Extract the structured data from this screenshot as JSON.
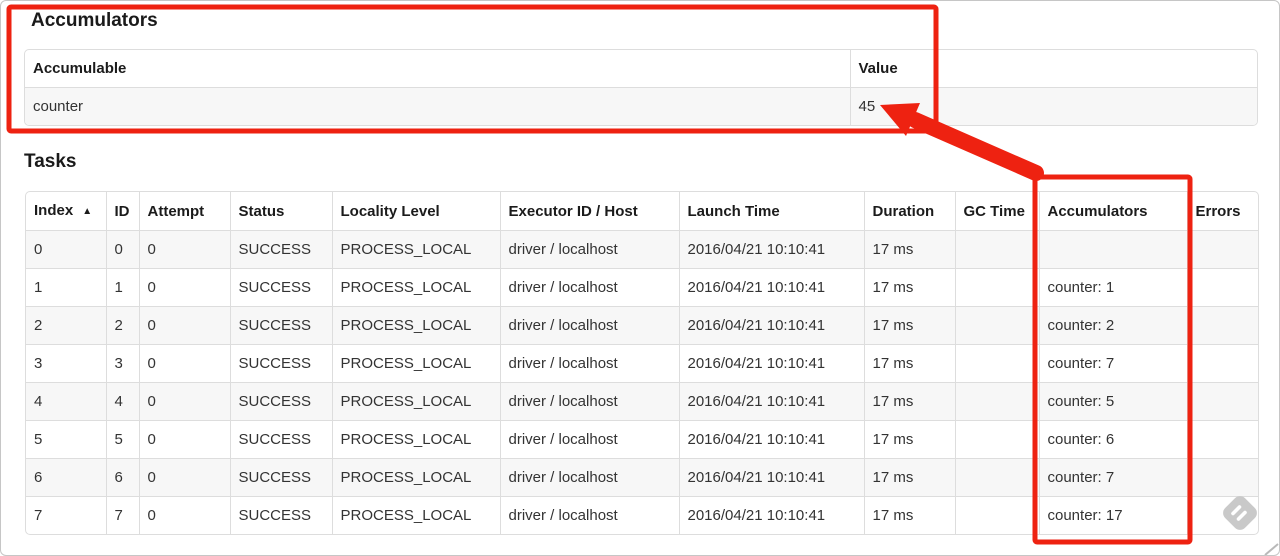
{
  "annotation": {
    "color": "#ee2211",
    "corner_mark_color": "#b9b9b9"
  },
  "watermark": {
    "icon": "feedly-icon",
    "color": "#c9c9c9"
  },
  "accumulators": {
    "title": "Accumulators",
    "headers": {
      "accumulable": "Accumulable",
      "value": "Value"
    },
    "rows": [
      {
        "accumulable": "counter",
        "value": "45"
      }
    ]
  },
  "tasks": {
    "title": "Tasks",
    "sort_icon": "▲",
    "headers": {
      "index": "Index",
      "id": "ID",
      "attempt": "Attempt",
      "status": "Status",
      "locality": "Locality Level",
      "executor": "Executor ID / Host",
      "launch": "Launch Time",
      "duration": "Duration",
      "gc": "GC Time",
      "accumulators": "Accumulators",
      "errors": "Errors"
    },
    "rows": [
      {
        "index": "0",
        "id": "0",
        "attempt": "0",
        "status": "SUCCESS",
        "locality": "PROCESS_LOCAL",
        "executor": "driver / localhost",
        "launch": "2016/04/21 10:10:41",
        "duration": "17 ms",
        "gc": "",
        "accumulators": "",
        "errors": ""
      },
      {
        "index": "1",
        "id": "1",
        "attempt": "0",
        "status": "SUCCESS",
        "locality": "PROCESS_LOCAL",
        "executor": "driver / localhost",
        "launch": "2016/04/21 10:10:41",
        "duration": "17 ms",
        "gc": "",
        "accumulators": "counter: 1",
        "errors": ""
      },
      {
        "index": "2",
        "id": "2",
        "attempt": "0",
        "status": "SUCCESS",
        "locality": "PROCESS_LOCAL",
        "executor": "driver / localhost",
        "launch": "2016/04/21 10:10:41",
        "duration": "17 ms",
        "gc": "",
        "accumulators": "counter: 2",
        "errors": ""
      },
      {
        "index": "3",
        "id": "3",
        "attempt": "0",
        "status": "SUCCESS",
        "locality": "PROCESS_LOCAL",
        "executor": "driver / localhost",
        "launch": "2016/04/21 10:10:41",
        "duration": "17 ms",
        "gc": "",
        "accumulators": "counter: 7",
        "errors": ""
      },
      {
        "index": "4",
        "id": "4",
        "attempt": "0",
        "status": "SUCCESS",
        "locality": "PROCESS_LOCAL",
        "executor": "driver / localhost",
        "launch": "2016/04/21 10:10:41",
        "duration": "17 ms",
        "gc": "",
        "accumulators": "counter: 5",
        "errors": ""
      },
      {
        "index": "5",
        "id": "5",
        "attempt": "0",
        "status": "SUCCESS",
        "locality": "PROCESS_LOCAL",
        "executor": "driver / localhost",
        "launch": "2016/04/21 10:10:41",
        "duration": "17 ms",
        "gc": "",
        "accumulators": "counter: 6",
        "errors": ""
      },
      {
        "index": "6",
        "id": "6",
        "attempt": "0",
        "status": "SUCCESS",
        "locality": "PROCESS_LOCAL",
        "executor": "driver / localhost",
        "launch": "2016/04/21 10:10:41",
        "duration": "17 ms",
        "gc": "",
        "accumulators": "counter: 7",
        "errors": ""
      },
      {
        "index": "7",
        "id": "7",
        "attempt": "0",
        "status": "SUCCESS",
        "locality": "PROCESS_LOCAL",
        "executor": "driver / localhost",
        "launch": "2016/04/21 10:10:41",
        "duration": "17 ms",
        "gc": "",
        "accumulators": "counter: 17",
        "errors": ""
      }
    ]
  }
}
